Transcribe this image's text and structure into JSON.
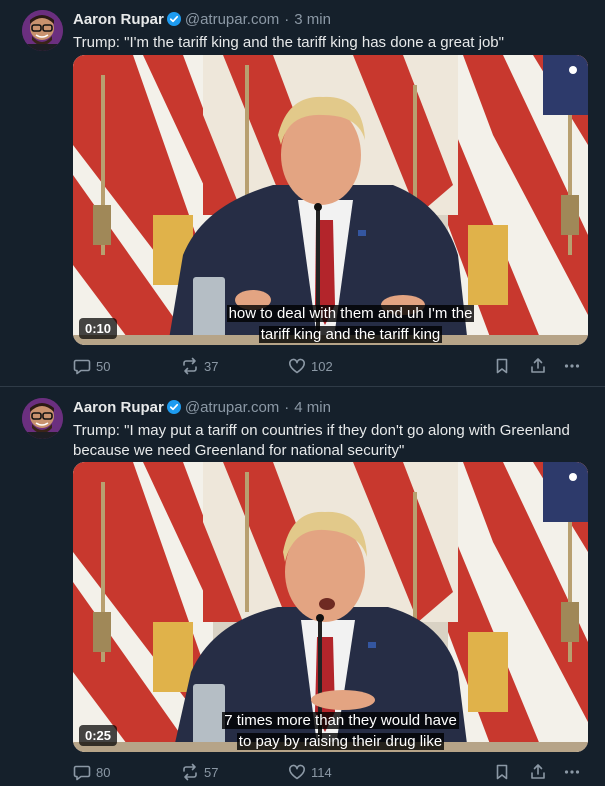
{
  "posts": [
    {
      "author": "Aaron Rupar",
      "handle": "@atrupar.com",
      "separator": "·",
      "time": "3 min",
      "text": "Trump: \"I'm the tariff king and the tariff king has done a great job\"",
      "video": {
        "duration": "0:10",
        "caption_line1": "how to deal with them and uh I'm the",
        "caption_line2": "tariff king and the tariff king"
      },
      "stats": {
        "replies": "50",
        "reposts": "37",
        "likes": "102"
      }
    },
    {
      "author": "Aaron Rupar",
      "handle": "@atrupar.com",
      "separator": "·",
      "time": "4 min",
      "text": "Trump: \"I may put a tariff on countries if they don't go along with Greenland because we need Greenland for national security\"",
      "video": {
        "duration": "0:25",
        "caption_line1": "7 times more than they would have",
        "caption_line2": "to pay by raising their drug like"
      },
      "stats": {
        "replies": "80",
        "reposts": "57",
        "likes": "114"
      }
    }
  ],
  "icons": {
    "verified": "verified-badge-icon",
    "reply": "reply-icon",
    "repost": "repost-icon",
    "like": "heart-icon",
    "bookmark": "bookmark-icon",
    "share": "share-icon",
    "more": "more-icon"
  },
  "colors": {
    "background": "#15202b",
    "text": "#e7e9ea",
    "muted": "#8b98a5",
    "verified": "#1d9bf0",
    "divider": "#2f3b47"
  }
}
